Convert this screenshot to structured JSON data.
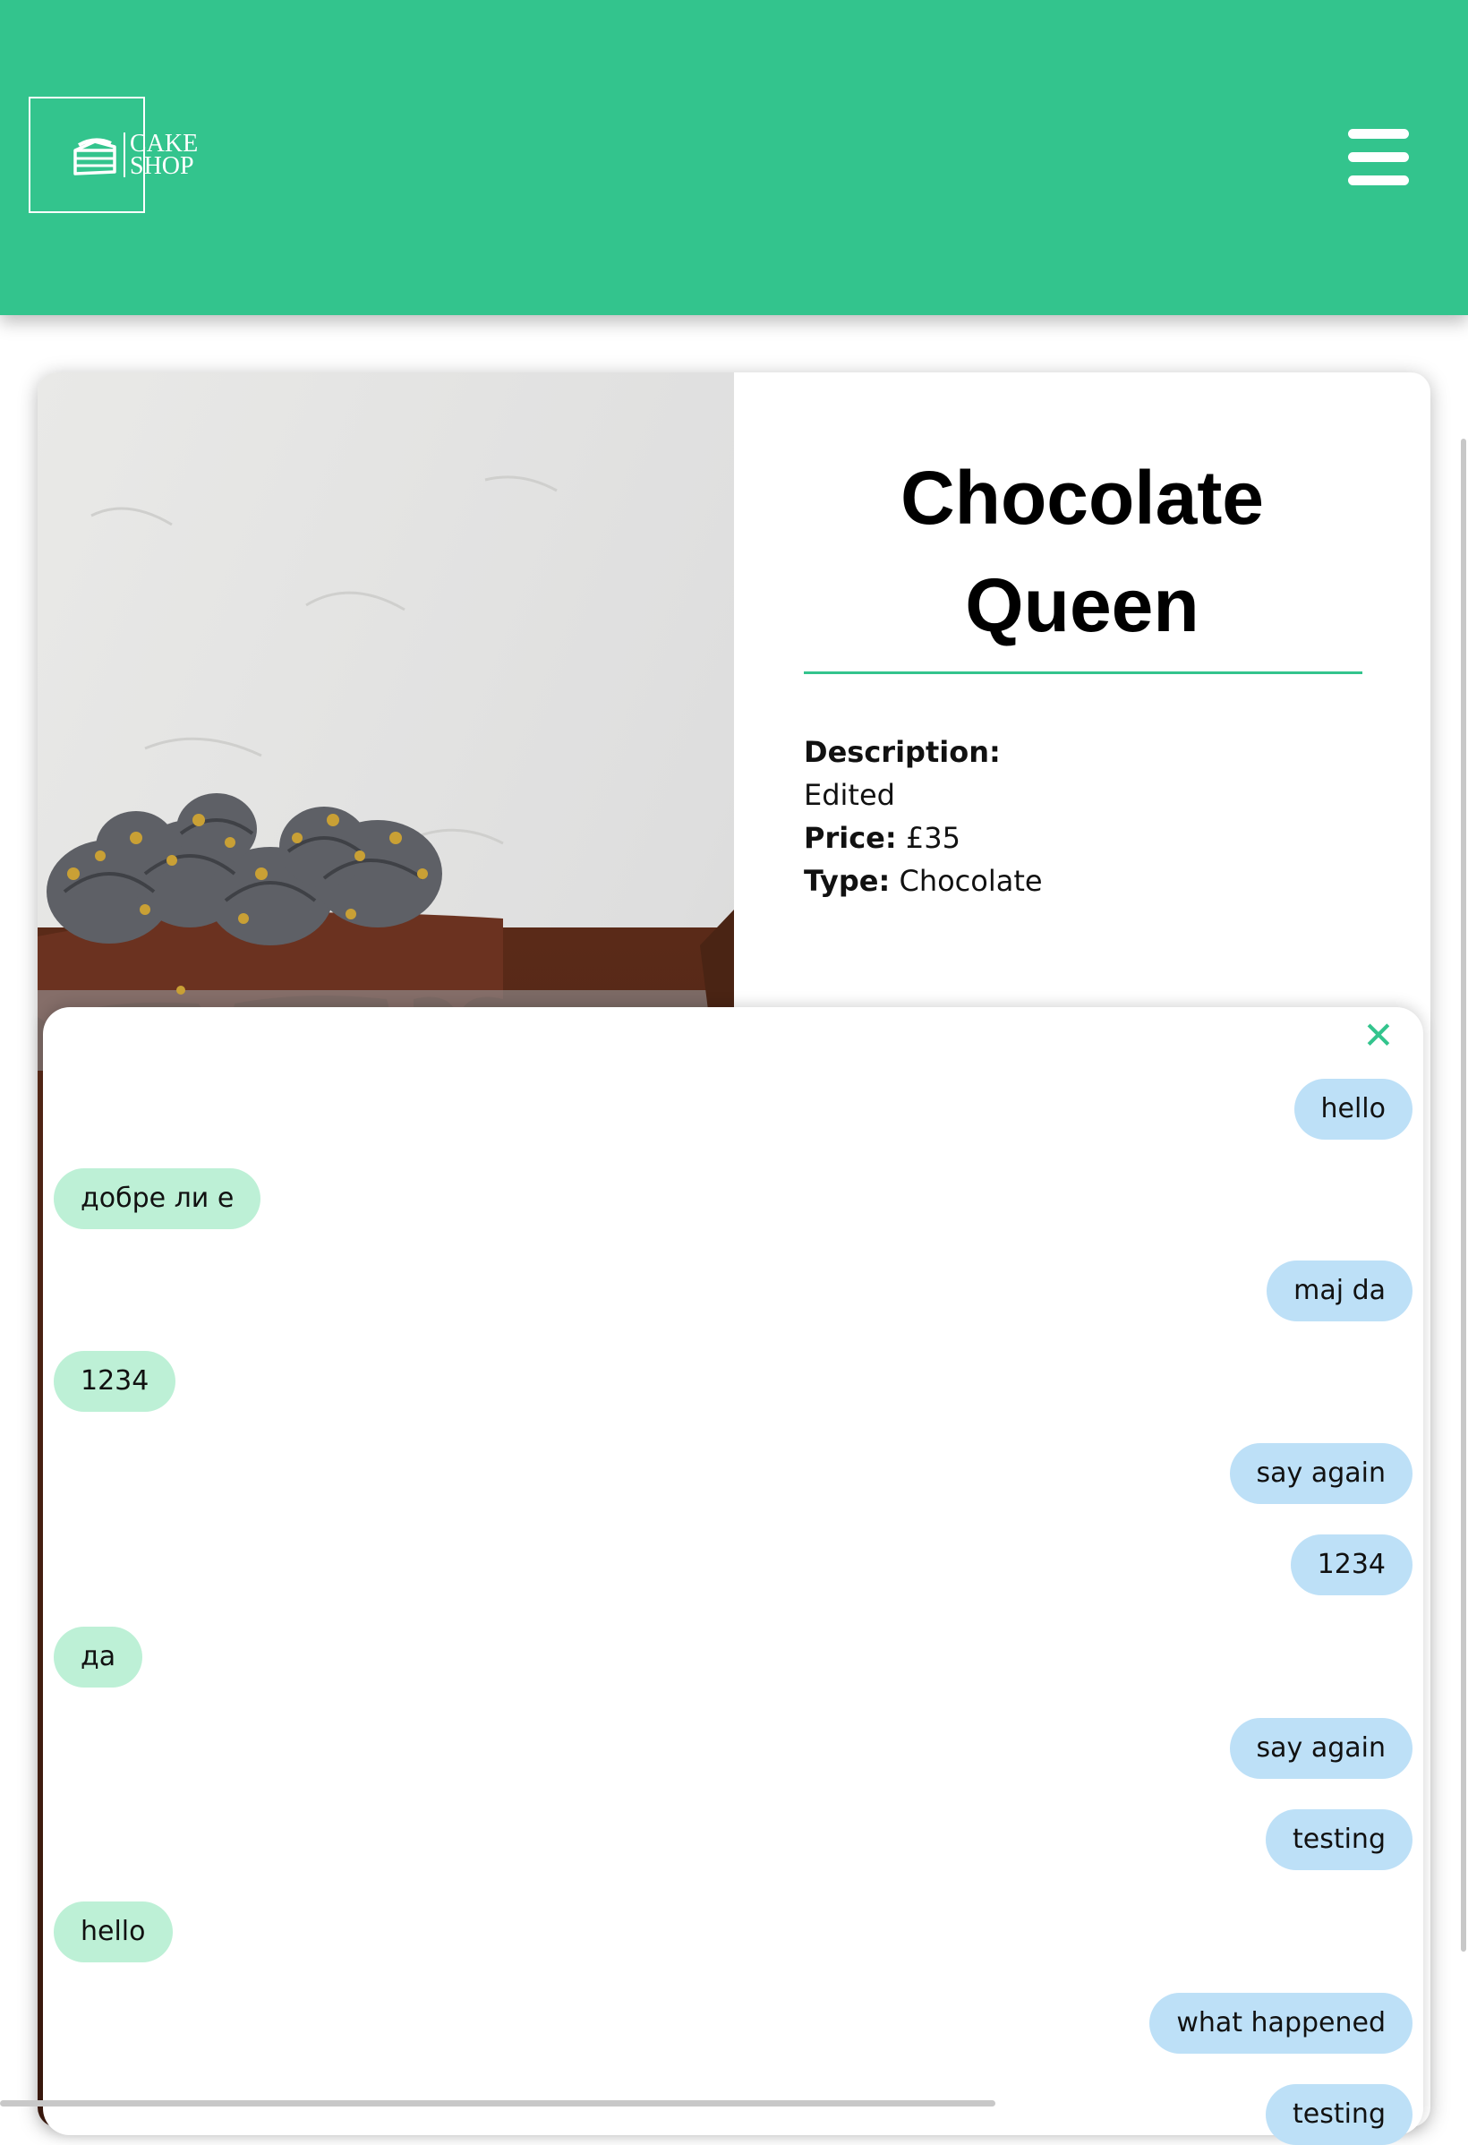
{
  "header": {
    "logo": {
      "icon": "cake-slice-icon",
      "line1": "CAKE",
      "line2": "SHOP"
    },
    "menu_icon": "hamburger-menu-icon",
    "background_color": "#33c48d"
  },
  "product": {
    "title_line1": "Chocolate",
    "title_line2": "Queen",
    "description_label": "Description:",
    "description_value": "Edited",
    "price_label": "Price:",
    "price_value": "£35",
    "type_label": "Type:",
    "type_value": "Chocolate"
  },
  "chat": {
    "close_icon": "close-icon",
    "sent_color": "#bde0f7",
    "received_color": "#bdf0d6",
    "messages": [
      {
        "side": "sent",
        "text": "hello"
      },
      {
        "side": "received",
        "text": "добре ли е"
      },
      {
        "side": "sent",
        "text": "maj da"
      },
      {
        "side": "received",
        "text": "1234"
      },
      {
        "side": "sent",
        "text": "say again"
      },
      {
        "side": "sent",
        "text": "1234"
      },
      {
        "side": "received",
        "text": "да"
      },
      {
        "side": "sent",
        "text": "say again"
      },
      {
        "side": "sent",
        "text": "testing"
      },
      {
        "side": "received",
        "text": "hello"
      },
      {
        "side": "sent",
        "text": "what happened"
      },
      {
        "side": "sent",
        "text": "testing"
      }
    ]
  }
}
